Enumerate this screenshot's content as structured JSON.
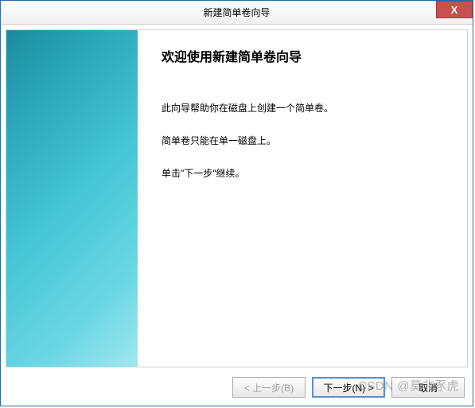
{
  "window": {
    "title": "新建简单卷向导",
    "close_symbol": "X"
  },
  "content": {
    "heading": "欢迎使用新建简单卷向导",
    "line1": "此向导帮助你在磁盘上创建一个简单卷。",
    "line2": "简单卷只能在单一磁盘上。",
    "line3": "单击\"下一步\"继续。"
  },
  "buttons": {
    "back": "< 上一步(B)",
    "next": "下一步(N) >",
    "cancel": "取消"
  },
  "watermark": "CSDN @莫非豕虎"
}
